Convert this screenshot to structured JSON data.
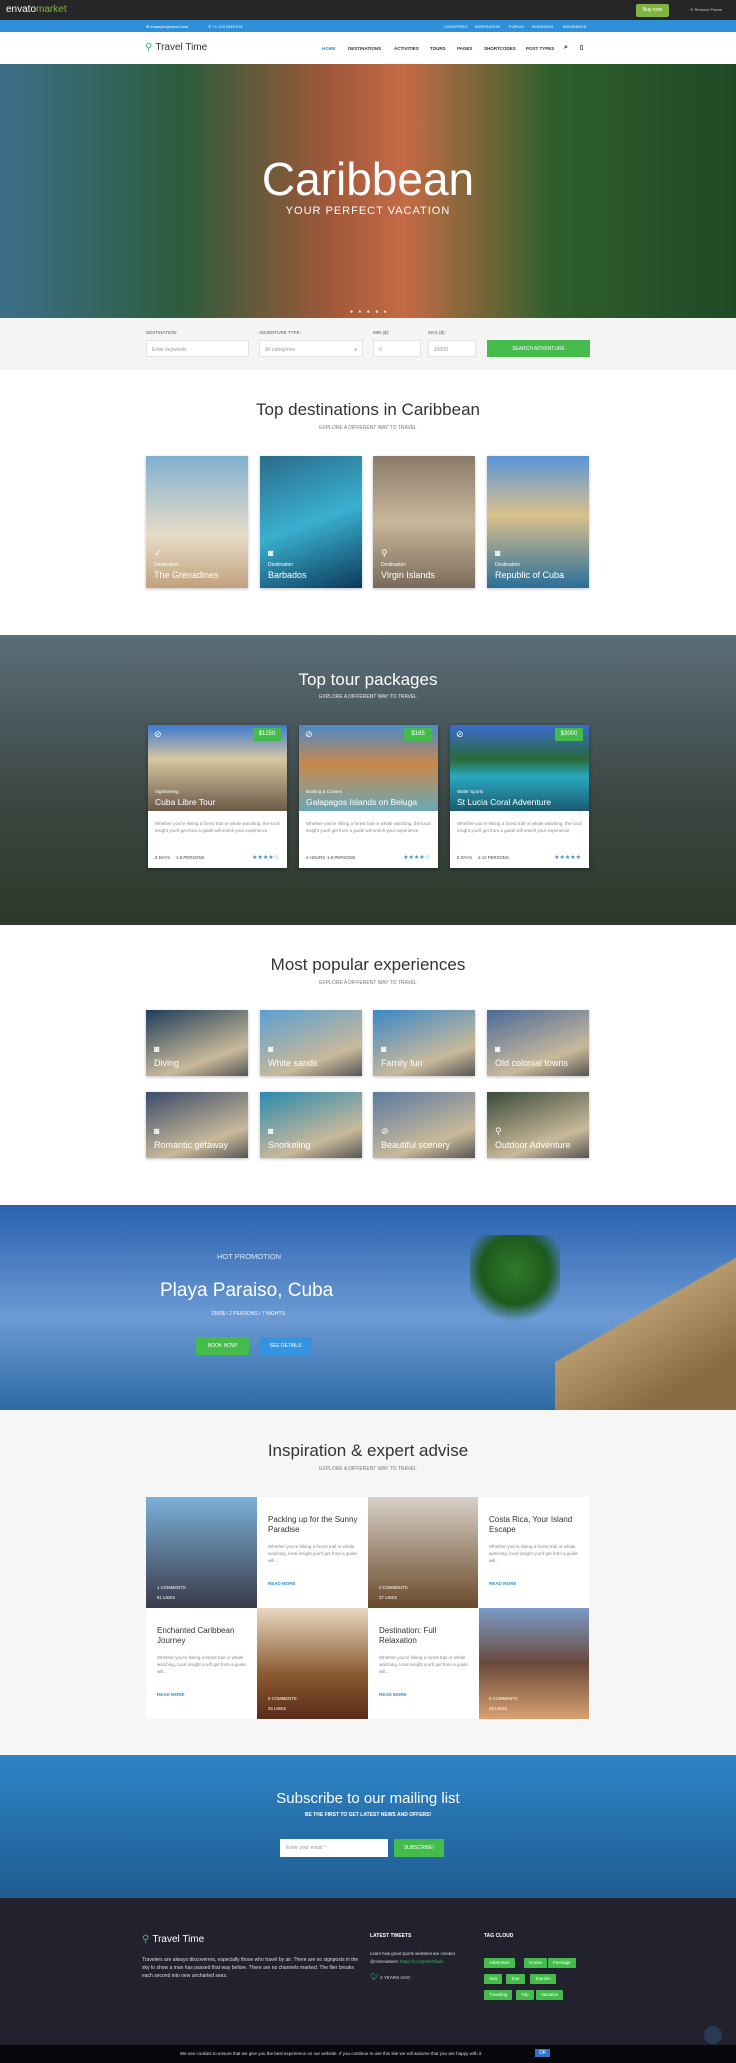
{
  "envato": {
    "logo_a": "envato",
    "logo_b": "market",
    "buy": "Buy now",
    "remove": "✕ Remove Frame"
  },
  "topbar": {
    "email": "✉ example@travel.com",
    "phone": "✆ +1 123 2345 678",
    "links": [
      "COUNTRIES",
      "INSPIRATION",
      "FORUM",
      "BOOKINGS",
      "INSURANCE"
    ]
  },
  "header": {
    "brand": "Travel Time",
    "nav": [
      "HOME",
      "DESTINATIONS",
      "ACTIVITIES",
      "TOURS",
      "PAGES",
      "SHORTCODES",
      "POST TYPES"
    ]
  },
  "hero": {
    "title": "Caribbean",
    "subtitle": "YOUR PERFECT VACATION",
    "dots": "● ● ● ● ●"
  },
  "search": {
    "destination_label": "DESTINATION:",
    "destination_placeholder": "Enter keywords",
    "type_label": "ADVENTURE TYPE:",
    "type_value": "All categories",
    "min_label": "MIN ($):",
    "min_value": "0",
    "max_label": "MAX ($):",
    "max_value": "10000",
    "button": "SEARCH ADVENTURE"
  },
  "destinations": {
    "title": "Top destinations in Caribbean",
    "subtitle": "EXPLORE A DIFFERENT WAY TO TRAVEL",
    "items": [
      {
        "cat": "Destination",
        "name": "The Grenadines",
        "icon": "✓"
      },
      {
        "cat": "Destination",
        "name": "Barbados",
        "icon": "◙"
      },
      {
        "cat": "Destination",
        "name": "Virgin Islands",
        "icon": "⚲"
      },
      {
        "cat": "Destination",
        "name": "Republic of Cuba",
        "icon": "◙"
      }
    ]
  },
  "tours": {
    "title": "Top tour packages",
    "subtitle": "EXPLORE A DIFFERENT WAY TO TRAVEL",
    "items": [
      {
        "price": "$1250",
        "cat": "Sightseeing",
        "name": "Cuba Libre Tour",
        "desc": "Whether you're hiking a forest trail or whale watching, the local insight you'll get from a guide will enrich your experience",
        "duration": "8 DAYS",
        "persons": "1-8 PERSONS",
        "stars": "★★★★☆"
      },
      {
        "price": "$185",
        "cat": "Boating & Cruises",
        "name": "Galapagos Islands on Beluga",
        "desc": "Whether you're hiking a forest trail or whale watching, the local insight you'll get from a guide will enrich your experience",
        "duration": "4 HOURS",
        "persons": "1-8 PERSONS",
        "stars": "★★★★☆"
      },
      {
        "price": "$3000",
        "cat": "Water Sports",
        "name": "St Lucia Coral Adventure",
        "desc": "Whether you're hiking a forest trail or whale watching, the local insight you'll get from a guide will enrich your experience",
        "duration": "8 DAYS",
        "persons": "1-12 PERSONS",
        "stars": "★★★★★"
      }
    ]
  },
  "experiences": {
    "title": "Most popular experiences",
    "subtitle": "EXPLORE A DIFFERENT WAY TO TRAVEL",
    "items": [
      {
        "name": "Diving",
        "icon": "◙"
      },
      {
        "name": "White sands",
        "icon": "◙"
      },
      {
        "name": "Family fun",
        "icon": "◙"
      },
      {
        "name": "Old colonial towns",
        "icon": "◙"
      },
      {
        "name": "Romantic getaway",
        "icon": "◙"
      },
      {
        "name": "Snorkeling",
        "icon": "◙"
      },
      {
        "name": "Beautiful scenery",
        "icon": "⊘"
      },
      {
        "name": "Outdoor Adventure",
        "icon": "⚲"
      }
    ]
  },
  "promo": {
    "kicker": "HOT PROMOTION",
    "title": "Playa Paraiso, Cuba",
    "details": "2300$ / 2 PERSONS / 7 NIGHTS",
    "book": "BOOK NOW!",
    "see": "SEE DETAILS"
  },
  "blog": {
    "title": "Inspiration & expert advise",
    "subtitle": "EXPLORE A DIFFERENT WAY TO TRAVEL",
    "excerpt": "Whether you're hiking a forest trail or whale watching, local insight you'll get from a guide will...",
    "read_more": "READ MORE",
    "posts": [
      {
        "title": "Packing up for the Sunny Paradise",
        "comments": "1 COMMENTS",
        "likes": "51 LIKES"
      },
      {
        "title": "Costa Rica, Your Island Escape",
        "comments": "0 COMMENTS",
        "likes": "37 LIKES"
      },
      {
        "title": "Enchanted Caribbean Journey",
        "comments": "0 COMMENTS",
        "likes": "33 LIKES"
      },
      {
        "title": "Destination: Full Relaxation",
        "comments": "0 COMMENTS",
        "likes": "28 LIKES"
      }
    ]
  },
  "subscribe": {
    "title": "Subscribe to our mailing list",
    "subtitle": "BE THE FIRST TO GET LATEST NEWS AND OFFERS!",
    "placeholder": "Enter your email *",
    "button": "SUBSCRIBE!"
  },
  "footer": {
    "brand": "Travel Time",
    "about": "Travelers are always discoverers, especially those who travel by air. There are no signposts in the sky to show a man has passed that way before. There are no channels marked. The flier breaks each second into new uncharted seas.",
    "tweets_title": "LATEST TWEETS",
    "tweet": "Learn how great sports websites are created @cmsmasters:",
    "tweet_link": "https://t.co/Qz9AOkwls",
    "tweet_time": "2 YEARS AGO",
    "tags_title": "TAG CLOUD",
    "tags": [
      "Adventure",
      "Cruise",
      "Package",
      "Sea",
      "Tour",
      "Tourism",
      "Traveling",
      "Trip",
      "Vacation"
    ]
  },
  "cookie": {
    "text": "We use cookies to ensure that we give you the best experience on our website. If you continue to use this site we will assume that you are happy with it.",
    "ok": "OK"
  }
}
